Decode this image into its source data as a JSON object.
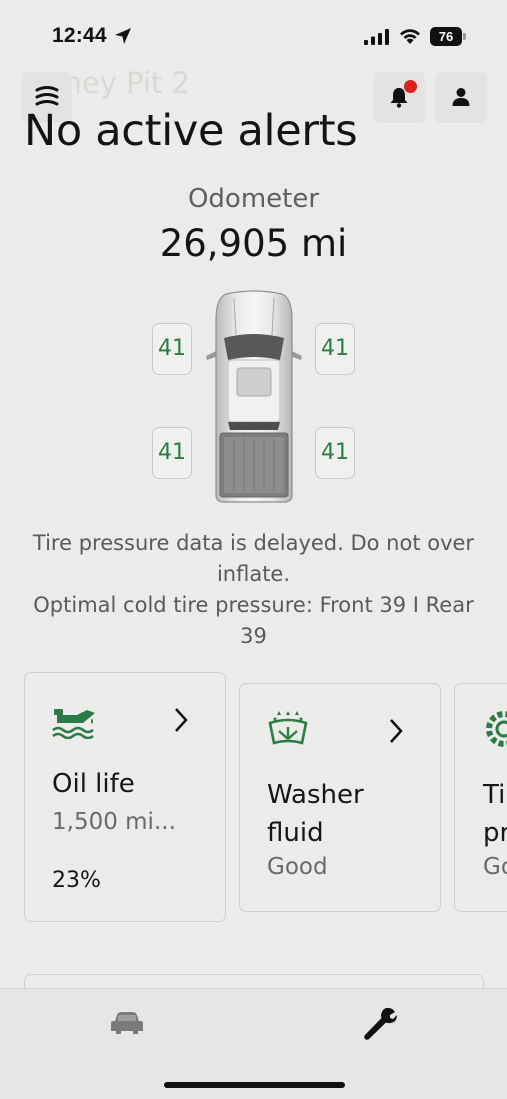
{
  "status_bar": {
    "time": "12:44",
    "battery": "76"
  },
  "header": {
    "vehicle_name": "Honey Pit 2",
    "menu_icon": "menu-icon",
    "bell_icon": "bell-icon",
    "profile_icon": "profile-icon",
    "notification_dot_color": "#d6241d"
  },
  "alerts": {
    "title": "No active alerts"
  },
  "odometer": {
    "label": "Odometer",
    "value": "26,905 mi"
  },
  "tires": {
    "front_left": "41",
    "front_right": "41",
    "rear_left": "41",
    "rear_right": "41",
    "value_color": "#2c7a46",
    "note_line1": "Tire pressure data is delayed. Do not over inflate.",
    "note_line2": "Optimal cold tire pressure: Front 39 I Rear 39"
  },
  "cards": [
    {
      "icon": "oil-can-icon",
      "title": "Oil life",
      "subtitle": "1,500 mi...",
      "value": "23%"
    },
    {
      "icon": "washer-fluid-icon",
      "title": "Washer fluid",
      "subtitle": "Good"
    },
    {
      "icon": "tire-gear-icon",
      "title": "Tire pressure",
      "subtitle": "Good"
    }
  ],
  "accent_color": "#2c7a46",
  "bottom_nav": {
    "items": [
      "vehicle-icon",
      "wrench-icon"
    ]
  }
}
